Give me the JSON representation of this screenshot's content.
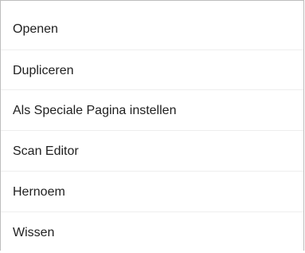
{
  "menu": {
    "items": [
      {
        "label": "Openen"
      },
      {
        "label": "Dupliceren"
      },
      {
        "label": "Als Speciale Pagina instellen"
      },
      {
        "label": "Scan Editor"
      },
      {
        "label": "Hernoem"
      },
      {
        "label": "Wissen"
      }
    ]
  }
}
